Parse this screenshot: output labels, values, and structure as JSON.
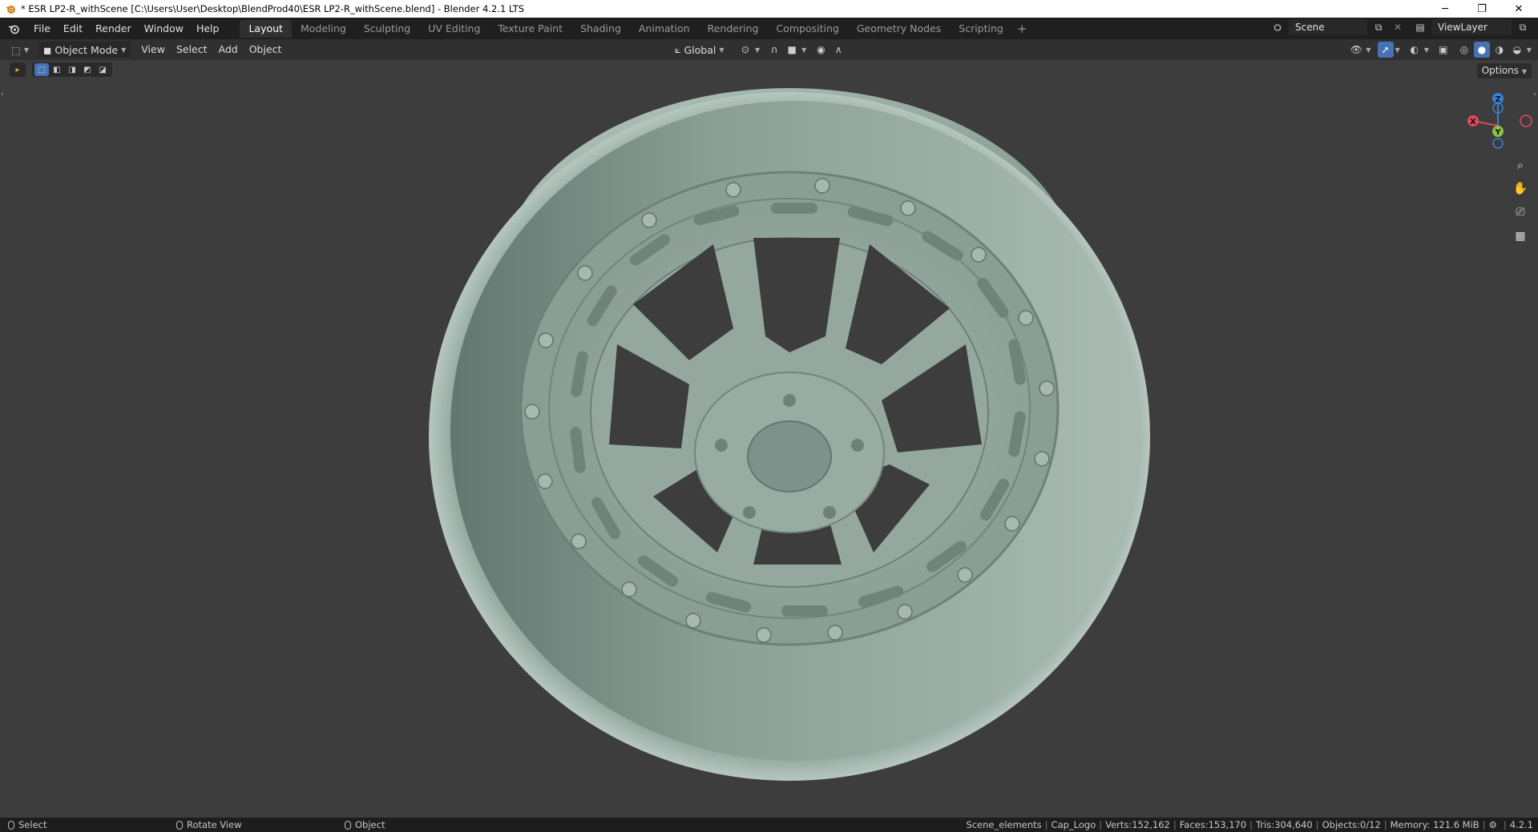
{
  "window": {
    "title": "* ESR LP2-R_withScene [C:\\Users\\User\\Desktop\\BlendProd40\\ESR LP2-R_withScene.blend] - Blender 4.2.1 LTS",
    "controls": [
      "minimize",
      "restore",
      "close"
    ]
  },
  "menu": {
    "items": [
      "File",
      "Edit",
      "Render",
      "Window",
      "Help"
    ]
  },
  "workspaces": {
    "tabs": [
      "Layout",
      "Modeling",
      "Sculpting",
      "UV Editing",
      "Texture Paint",
      "Shading",
      "Animation",
      "Rendering",
      "Compositing",
      "Geometry Nodes",
      "Scripting"
    ],
    "active": "Layout",
    "add_label": "+"
  },
  "scene": {
    "name": "Scene",
    "view_layer": "ViewLayer"
  },
  "header": {
    "mode": "Object Mode",
    "menus": [
      "View",
      "Select",
      "Add",
      "Object"
    ],
    "transform_orientation": "Global"
  },
  "viewport": {
    "options_label": "Options",
    "object": "alloy wheel rim",
    "colors": {
      "background": "#3d3d3d",
      "wheel": "#8fa39a",
      "wheel_shadow": "#6e827a",
      "wheel_highlight": "#b7c8c0"
    }
  },
  "gizmo": {
    "x_label": "X",
    "y_label": "Y",
    "z_label": "Z",
    "colors": {
      "x": "#e04a5a",
      "y": "#8bc53f",
      "z": "#3a7fd9"
    }
  },
  "nav_icons": [
    "zoom-icon",
    "pan-hand-icon",
    "camera-icon",
    "perspective-grid-icon"
  ],
  "status": {
    "left": [
      {
        "icon": "mouse-left-icon",
        "label": "Select"
      },
      {
        "icon": "mouse-middle-icon",
        "label": "Rotate View"
      },
      {
        "icon": "mouse-right-icon",
        "label": "Object"
      }
    ],
    "collection": "Scene_elements",
    "active_object": "Cap_Logo",
    "verts": "Verts:152,162",
    "faces": "Faces:153,170",
    "tris": "Tris:304,640",
    "objects": "Objects:0/12",
    "memory": "Memory: 121.6 MiB",
    "version": "4.2.1"
  }
}
